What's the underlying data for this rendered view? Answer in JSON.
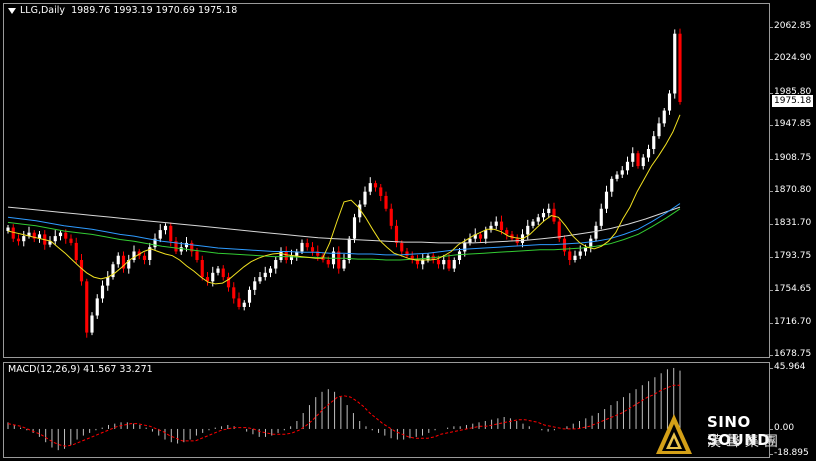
{
  "chart": {
    "symbol_title": "LLG,Daily",
    "ohlc_text": "1989.76 1993.19 1970.69 1975.18",
    "last_price": "1975.18",
    "y_ticks": [
      "2062.85",
      "2024.90",
      "1985.80",
      "1947.85",
      "1908.75",
      "1870.80",
      "1831.70",
      "1793.75",
      "1754.65",
      "1716.70",
      "1678.75"
    ],
    "colors": {
      "up": "#ffffff",
      "down": "#ff0000",
      "background": "#000000",
      "frame": "#9a9a9a"
    }
  },
  "macd": {
    "title": "MACD(12,26,9) 41.567 33.271",
    "y_ticks": [
      "45.964",
      "0.00",
      "-18.895"
    ],
    "colors": {
      "histogram": "#c0c0c0",
      "signal": "#ff0000"
    }
  },
  "logo": {
    "name_en": "SINO SOUND",
    "name_cn": "漢聲集團"
  },
  "chart_data": {
    "type": "candlestick",
    "title": "LLG,Daily",
    "ylim": [
      1678.75,
      2062.85
    ],
    "candles_close": [
      1828,
      1815,
      1812,
      1818,
      1822,
      1815,
      1820,
      1808,
      1812,
      1818,
      1822,
      1815,
      1810,
      1790,
      1765,
      1705,
      1725,
      1745,
      1760,
      1770,
      1785,
      1795,
      1780,
      1790,
      1800,
      1795,
      1790,
      1805,
      1815,
      1825,
      1830,
      1812,
      1800,
      1805,
      1810,
      1800,
      1790,
      1770,
      1765,
      1775,
      1780,
      1770,
      1758,
      1745,
      1735,
      1740,
      1755,
      1765,
      1770,
      1775,
      1780,
      1790,
      1800,
      1790,
      1795,
      1800,
      1810,
      1805,
      1800,
      1795,
      1790,
      1785,
      1800,
      1780,
      1790,
      1815,
      1840,
      1855,
      1870,
      1880,
      1875,
      1865,
      1850,
      1830,
      1810,
      1800,
      1795,
      1790,
      1785,
      1790,
      1795,
      1790,
      1785,
      1790,
      1780,
      1790,
      1800,
      1810,
      1815,
      1820,
      1815,
      1825,
      1830,
      1835,
      1825,
      1820,
      1815,
      1810,
      1820,
      1830,
      1835,
      1840,
      1845,
      1850,
      1835,
      1815,
      1800,
      1790,
      1795,
      1800,
      1805,
      1815,
      1830,
      1850,
      1870,
      1885,
      1890,
      1895,
      1905,
      1915,
      1900,
      1910,
      1920,
      1935,
      1950,
      1965,
      1985,
      2055,
      1975
    ],
    "sma_short": [
      1824,
      1822,
      1820,
      1818,
      1816,
      1814,
      1812,
      1805,
      1798,
      1790,
      1782,
      1775,
      1770,
      1768,
      1770,
      1775,
      1782,
      1790,
      1795,
      1800,
      1803,
      1800,
      1797,
      1795,
      1790,
      1783,
      1777,
      1770,
      1764,
      1762,
      1763,
      1768,
      1775,
      1782,
      1788,
      1792,
      1795,
      1797,
      1798,
      1796,
      1795,
      1794,
      1793,
      1792,
      1792,
      1810,
      1835,
      1858,
      1860,
      1852,
      1840,
      1826,
      1813,
      1805,
      1798,
      1795,
      1792,
      1790,
      1790,
      1790,
      1791,
      1795,
      1800,
      1808,
      1813,
      1818,
      1822,
      1826,
      1826,
      1823,
      1818,
      1816,
      1815,
      1820,
      1828,
      1836,
      1842,
      1840,
      1830,
      1818,
      1810,
      1805,
      1803,
      1806,
      1812,
      1822,
      1838,
      1852,
      1870,
      1885,
      1900,
      1912,
      1925,
      1940,
      1960
    ],
    "sma_mid": [
      1840,
      1838,
      1836,
      1833,
      1830,
      1828,
      1826,
      1823,
      1820,
      1818,
      1815,
      1812,
      1810,
      1808,
      1806,
      1804,
      1803,
      1802,
      1801,
      1800,
      1800,
      1799,
      1799,
      1798,
      1798,
      1797,
      1797,
      1796,
      1796,
      1797,
      1798,
      1800,
      1802,
      1803,
      1804,
      1805,
      1806,
      1807,
      1808,
      1808,
      1809,
      1810,
      1812,
      1815,
      1820,
      1826,
      1835,
      1845,
      1856
    ],
    "sma_long": [
      1852,
      1850,
      1848,
      1846,
      1844,
      1842,
      1840,
      1838,
      1836,
      1834,
      1832,
      1830,
      1828,
      1826,
      1824,
      1822,
      1820,
      1818,
      1816,
      1815,
      1814,
      1813,
      1812,
      1811,
      1811,
      1810,
      1810,
      1810,
      1811,
      1812,
      1813,
      1815,
      1817,
      1820,
      1823,
      1827,
      1832,
      1838,
      1845,
      1852
    ],
    "macd_hist": [
      5,
      3,
      1,
      -1,
      -3,
      -6,
      -10,
      -14,
      -16,
      -15,
      -12,
      -8,
      -5,
      -3,
      -1,
      1,
      3,
      4,
      5,
      5,
      4,
      3,
      1,
      -2,
      -5,
      -8,
      -10,
      -11,
      -10,
      -8,
      -5,
      -3,
      -1,
      1,
      2,
      3,
      2,
      0,
      -2,
      -4,
      -6,
      -6,
      -5,
      -3,
      -1,
      2,
      6,
      12,
      18,
      24,
      28,
      30,
      28,
      24,
      18,
      12,
      6,
      2,
      -1,
      -3,
      -5,
      -7,
      -8,
      -8,
      -7,
      -6,
      -5,
      -3,
      -1,
      0,
      1,
      2,
      2,
      3,
      4,
      5,
      6,
      7,
      8,
      9,
      8,
      6,
      4,
      2,
      0,
      -1,
      -2,
      -1,
      0,
      2,
      4,
      6,
      8,
      10,
      12,
      15,
      18,
      21,
      24,
      27,
      30,
      33,
      36,
      39,
      42,
      45,
      46,
      44
    ],
    "macd_signal": [
      4,
      3,
      2,
      0,
      -2,
      -4,
      -7,
      -10,
      -12,
      -13,
      -12,
      -10,
      -8,
      -6,
      -4,
      -2,
      0,
      2,
      3,
      4,
      4,
      3,
      2,
      0,
      -2,
      -5,
      -7,
      -9,
      -9,
      -9,
      -7,
      -5,
      -3,
      -1,
      0,
      1,
      1,
      1,
      0,
      -2,
      -3,
      -4,
      -4,
      -4,
      -3,
      -1,
      2,
      6,
      11,
      16,
      20,
      24,
      25,
      24,
      21,
      17,
      12,
      8,
      4,
      1,
      -2,
      -4,
      -6,
      -7,
      -7,
      -7,
      -6,
      -4,
      -3,
      -2,
      -1,
      0,
      1,
      2,
      2,
      3,
      4,
      5,
      6,
      7,
      7,
      6,
      5,
      3,
      2,
      1,
      0,
      0,
      0,
      1,
      2,
      4,
      6,
      8,
      10,
      12,
      15,
      18,
      21,
      24,
      26,
      29,
      31,
      33,
      33
    ]
  }
}
